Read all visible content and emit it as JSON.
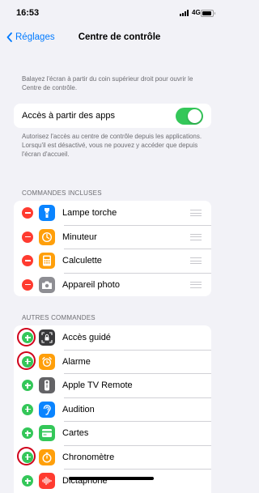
{
  "status_bar": {
    "time": "16:53",
    "network": "4G"
  },
  "nav": {
    "back_label": "Réglages",
    "title": "Centre de contrôle"
  },
  "intro_text": "Balayez l'écran à partir du coin supérieur droit pour ouvrir le Centre de contrôle.",
  "access_toggle": {
    "label": "Accès à partir des apps",
    "enabled": true,
    "footnote": "Autorisez l'accès au centre de contrôle depuis les applications. Lorsqu'il est désactivé, vous ne pouvez y accéder que depuis l'écran d'accueil."
  },
  "included": {
    "header": "COMMANDES INCLUSES",
    "items": [
      {
        "label": "Lampe torche",
        "icon": "flashlight-icon",
        "color": "#0a84ff"
      },
      {
        "label": "Minuteur",
        "icon": "timer-icon",
        "color": "#ff9f0a"
      },
      {
        "label": "Calculette",
        "icon": "calculator-icon",
        "color": "#ff9f0a"
      },
      {
        "label": "Appareil photo",
        "icon": "camera-icon",
        "color": "#8e8e93"
      }
    ]
  },
  "more": {
    "header": "AUTRES COMMANDES",
    "items": [
      {
        "label": "Accès guidé",
        "icon": "lock-icon",
        "color": "#3a3a3c",
        "highlighted": true
      },
      {
        "label": "Alarme",
        "icon": "alarm-icon",
        "color": "#ff9f0a",
        "highlighted": true
      },
      {
        "label": "Apple TV Remote",
        "icon": "remote-icon",
        "color": "#636366",
        "highlighted": false
      },
      {
        "label": "Audition",
        "icon": "ear-icon",
        "color": "#0a84ff",
        "highlighted": false
      },
      {
        "label": "Cartes",
        "icon": "wallet-icon",
        "color": "#34c759",
        "highlighted": false
      },
      {
        "label": "Chronomètre",
        "icon": "stopwatch-icon",
        "color": "#ff9f0a",
        "highlighted": true
      },
      {
        "label": "Dictaphone",
        "icon": "waveform-icon",
        "color": "#ff3b30",
        "highlighted": false
      }
    ]
  },
  "colors": {
    "accent": "#007aff",
    "toggle_on": "#34c759",
    "remove": "#ff3b30",
    "add": "#34c759",
    "highlight_ring": "#d0021b"
  }
}
